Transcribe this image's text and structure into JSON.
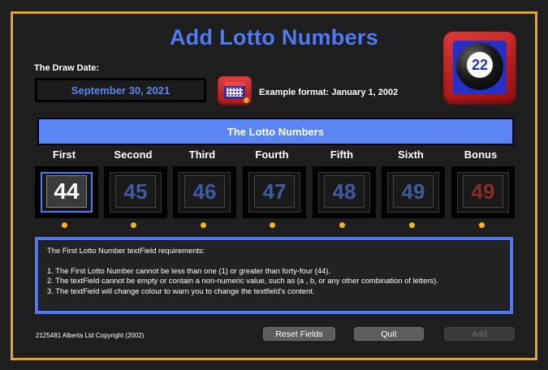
{
  "window": {
    "title": "Add Lotto Numbers",
    "accent": "#4e7bf5",
    "border_color": "#e8a524"
  },
  "logo": {
    "number": "22",
    "icon": "lotto-ball-icon"
  },
  "draw_date": {
    "label": "The Draw Date:",
    "value": "September 30, 2021",
    "calendar_icon": "calendar-icon",
    "example": "Example format: January 1, 2002"
  },
  "lotto_section": {
    "header": "The Lotto Numbers",
    "columns": [
      {
        "label": "First",
        "value": "44",
        "active": true
      },
      {
        "label": "Second",
        "value": "45"
      },
      {
        "label": "Third",
        "value": "46"
      },
      {
        "label": "Fourth",
        "value": "47"
      },
      {
        "label": "Fifth",
        "value": "48"
      },
      {
        "label": "Sixth",
        "value": "49"
      },
      {
        "label": "Bonus",
        "value": "49",
        "bonus": true
      }
    ],
    "indicator_color": "#f0b522"
  },
  "requirements": {
    "heading": "The First Lotto Number textField requirements:",
    "lines": [
      "1. The First Lotto Number cannot be less than one (1) or greater than forty-four (44).",
      "2. The textField cannot be empty or contain a non-numeric value, such as (a , b, or any other combination of letters).",
      "3. The textField will change colour to warn you to change the textfield's content."
    ]
  },
  "footer": {
    "copyright": "2125481 Alberta Ltd Copyright (2002)",
    "reset_label": "Reset Fields",
    "quit_label": "Quit",
    "add_label": "Add"
  }
}
